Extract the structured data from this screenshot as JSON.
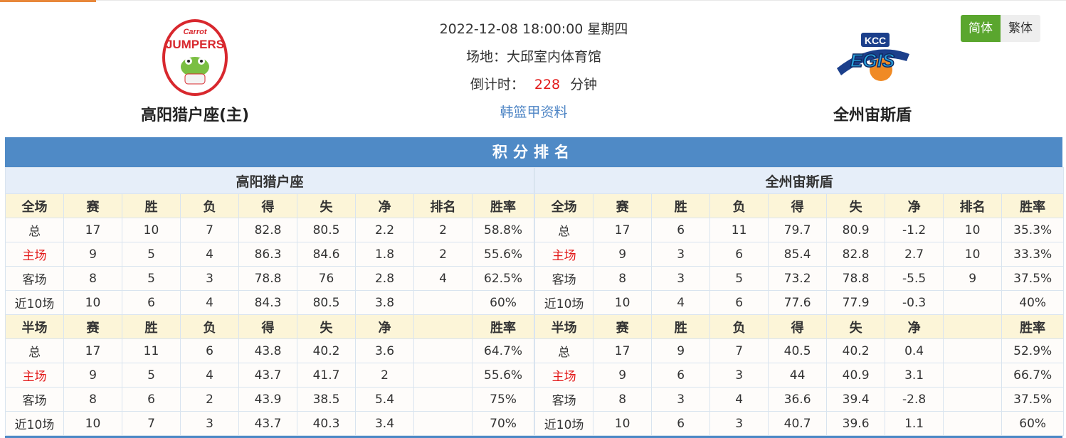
{
  "match": {
    "datetime": "2022-12-08 18:00:00 星期四",
    "venue": "场地：大邱室内体育馆",
    "countdown_label": "倒计时：",
    "countdown_value": "228",
    "countdown_unit": "分钟",
    "league_link": "韩篮甲资料"
  },
  "home_team": {
    "name": "高阳猎户座(主)",
    "logo_text_top": "Carrot",
    "logo_text_main": "JUMPERS"
  },
  "away_team": {
    "name": "全州宙斯盾",
    "logo_text_top": "KCC",
    "logo_text_main": "EGIS"
  },
  "lang_toggle": {
    "simplified": "简体",
    "traditional": "繁体"
  },
  "standings": {
    "title": "积分排名",
    "tables": [
      {
        "team": "高阳猎户座",
        "full_header": [
          "全场",
          "赛",
          "胜",
          "负",
          "得",
          "失",
          "净",
          "排名",
          "胜率"
        ],
        "full_rows": [
          [
            "总",
            "17",
            "10",
            "7",
            "82.8",
            "80.5",
            "2.2",
            "2",
            "58.8%"
          ],
          [
            "主场",
            "9",
            "5",
            "4",
            "86.3",
            "84.6",
            "1.8",
            "2",
            "55.6%"
          ],
          [
            "客场",
            "8",
            "5",
            "3",
            "78.8",
            "76",
            "2.8",
            "4",
            "62.5%"
          ],
          [
            "近10场",
            "10",
            "6",
            "4",
            "84.3",
            "80.5",
            "3.8",
            "",
            "60%"
          ]
        ],
        "half_header": [
          "半场",
          "赛",
          "胜",
          "负",
          "得",
          "失",
          "净",
          "",
          "胜率"
        ],
        "half_rows": [
          [
            "总",
            "17",
            "11",
            "6",
            "43.8",
            "40.2",
            "3.6",
            "",
            "64.7%"
          ],
          [
            "主场",
            "9",
            "5",
            "4",
            "43.7",
            "41.7",
            "2",
            "",
            "55.6%"
          ],
          [
            "客场",
            "8",
            "6",
            "2",
            "43.9",
            "38.5",
            "5.4",
            "",
            "75%"
          ],
          [
            "近10场",
            "10",
            "7",
            "3",
            "43.7",
            "40.3",
            "3.4",
            "",
            "70%"
          ]
        ]
      },
      {
        "team": "全州宙斯盾",
        "full_header": [
          "全场",
          "赛",
          "胜",
          "负",
          "得",
          "失",
          "净",
          "排名",
          "胜率"
        ],
        "full_rows": [
          [
            "总",
            "17",
            "6",
            "11",
            "79.7",
            "80.9",
            "-1.2",
            "10",
            "35.3%"
          ],
          [
            "主场",
            "9",
            "3",
            "6",
            "85.4",
            "82.8",
            "2.7",
            "10",
            "33.3%"
          ],
          [
            "客场",
            "8",
            "3",
            "5",
            "73.2",
            "78.8",
            "-5.5",
            "9",
            "37.5%"
          ],
          [
            "近10场",
            "10",
            "4",
            "6",
            "77.6",
            "77.9",
            "-0.3",
            "",
            "40%"
          ]
        ],
        "half_header": [
          "半场",
          "赛",
          "胜",
          "负",
          "得",
          "失",
          "净",
          "",
          "胜率"
        ],
        "half_rows": [
          [
            "总",
            "17",
            "9",
            "7",
            "40.5",
            "40.2",
            "0.4",
            "",
            "52.9%"
          ],
          [
            "主场",
            "9",
            "6",
            "3",
            "44",
            "40.9",
            "3.1",
            "",
            "66.7%"
          ],
          [
            "客场",
            "8",
            "3",
            "4",
            "36.6",
            "39.4",
            "-2.8",
            "",
            "37.5%"
          ],
          [
            "近10场",
            "10",
            "6",
            "3",
            "40.7",
            "39.6",
            "1.1",
            "",
            "60%"
          ]
        ]
      }
    ]
  },
  "colors": {
    "title_bar": "#4f8ac6",
    "home_label": "#e21a1a",
    "lang_active": "#5aa62e",
    "header_bg": "#fcf5d8"
  }
}
